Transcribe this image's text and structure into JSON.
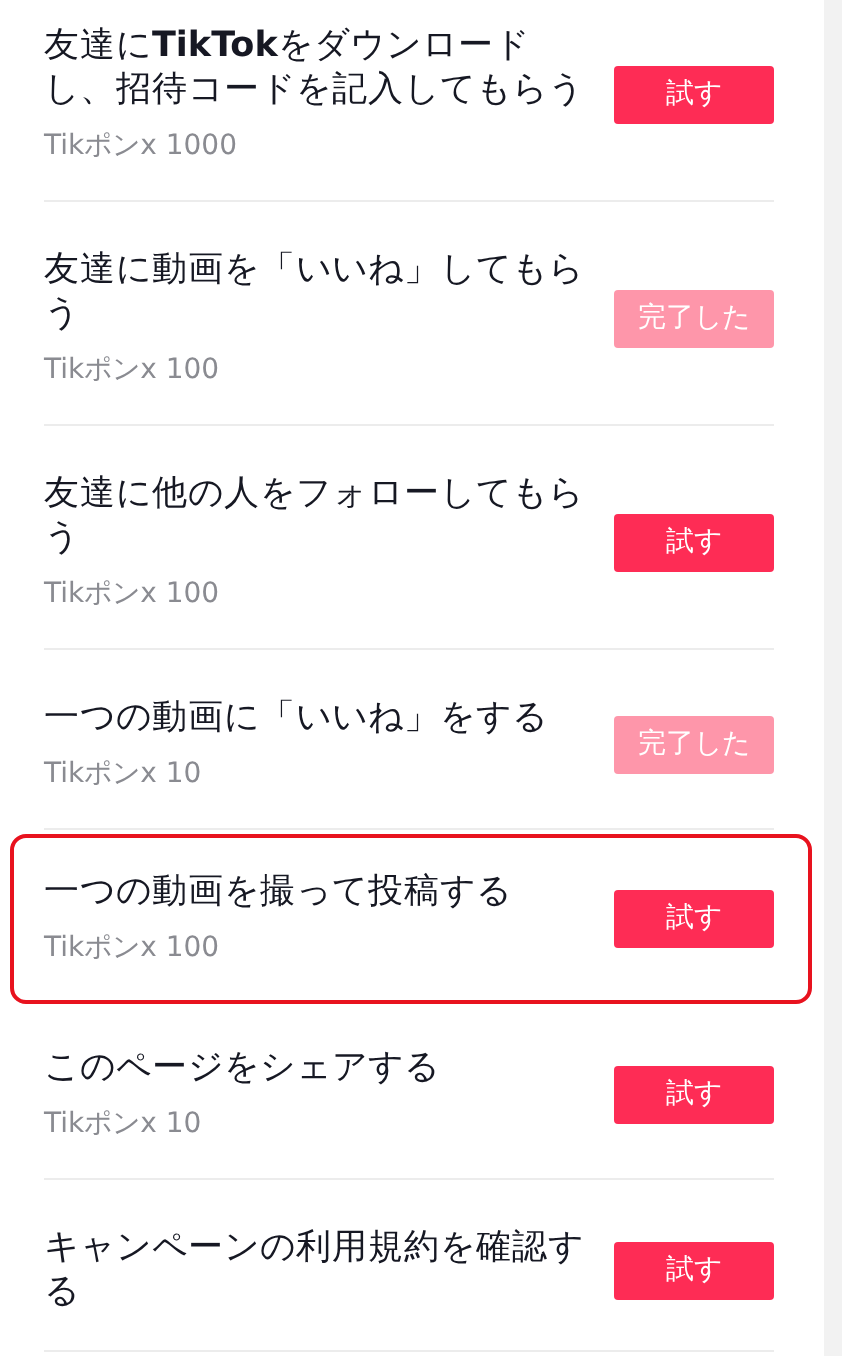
{
  "tasks": [
    {
      "title": "友達に**TikTok**をダウンロードし、招待コードを記入してもらう",
      "reward": "Tikポンx 1000",
      "button": "試す",
      "completed": false,
      "highlighted": false
    },
    {
      "title": "友達に動画を「いいね」してもらう",
      "reward": "Tikポンx 100",
      "button": "完了した",
      "completed": true,
      "highlighted": false
    },
    {
      "title": "友達に他の人をフォローしてもらう",
      "reward": "Tikポンx 100",
      "button": "試す",
      "completed": false,
      "highlighted": false
    },
    {
      "title": "一つの動画に「いいね」をする",
      "reward": "Tikポンx 10",
      "button": "完了した",
      "completed": true,
      "highlighted": false
    },
    {
      "title": "一つの動画を撮って投稿する",
      "reward": "Tikポンx 100",
      "button": "試す",
      "completed": false,
      "highlighted": true
    },
    {
      "title": "このページをシェアする",
      "reward": "Tikポンx 10",
      "button": "試す",
      "completed": false,
      "highlighted": false
    },
    {
      "title": "キャンペーンの利用規約を確認する",
      "button": "試す",
      "completed": false,
      "highlighted": false
    }
  ]
}
